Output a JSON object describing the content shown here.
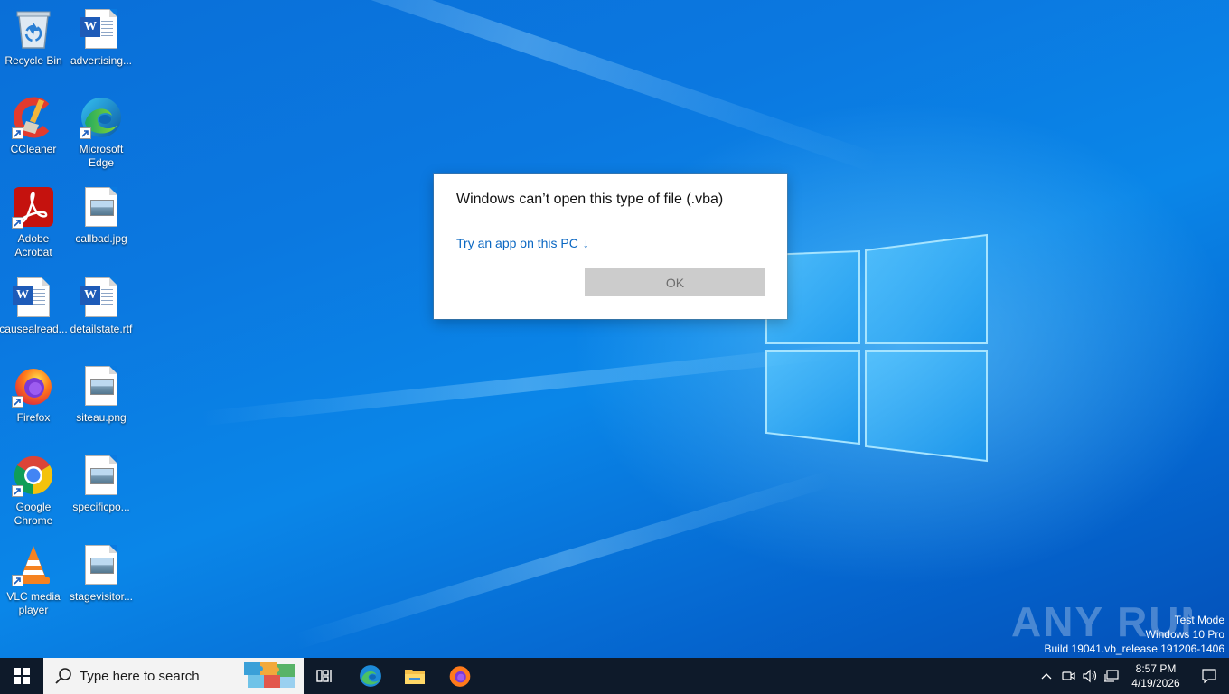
{
  "desktop": {
    "icons": [
      {
        "label": "Recycle Bin",
        "icon": "recycle-bin-icon"
      },
      {
        "label": "advertising...",
        "icon": "word-document-icon"
      },
      {
        "label": "CCleaner",
        "icon": "ccleaner-icon"
      },
      {
        "label": "Microsoft Edge",
        "icon": "edge-icon"
      },
      {
        "label": "Adobe Acrobat",
        "icon": "acrobat-icon"
      },
      {
        "label": "callbad.jpg",
        "icon": "image-file-icon"
      },
      {
        "label": "causealread...",
        "icon": "word-document-icon"
      },
      {
        "label": "detailstate.rtf",
        "icon": "word-document-icon"
      },
      {
        "label": "Firefox",
        "icon": "firefox-icon"
      },
      {
        "label": "siteau.png",
        "icon": "image-file-icon"
      },
      {
        "label": "Google Chrome",
        "icon": "chrome-icon"
      },
      {
        "label": "specificpo...",
        "icon": "image-file-icon"
      },
      {
        "label": "VLC media player",
        "icon": "vlc-icon"
      },
      {
        "label": "stagevisitor...",
        "icon": "image-file-icon"
      }
    ]
  },
  "dialog": {
    "title": "Windows can’t open this type of file (.vba)",
    "link": "Try an app on this PC",
    "link_arrow": "↓",
    "ok_label": "OK"
  },
  "watermark": {
    "logo_text": "ANY RUN",
    "test_mode": "Test Mode",
    "edition": "Windows 10 Pro",
    "build": "Build 19041.vb_release.191206-1406"
  },
  "taskbar": {
    "search_placeholder": "Type here to search",
    "pinned": [
      "task-view-icon",
      "edge-icon",
      "file-explorer-icon",
      "firefox-icon"
    ],
    "clock_time": "8:57 PM",
    "clock_date": "4/19/2026"
  },
  "colors": {
    "desktop_blue": "#0a78e0",
    "taskbar": "#0e1a2a",
    "link": "#0a67c2",
    "ok_button_bg": "#cccccc"
  }
}
